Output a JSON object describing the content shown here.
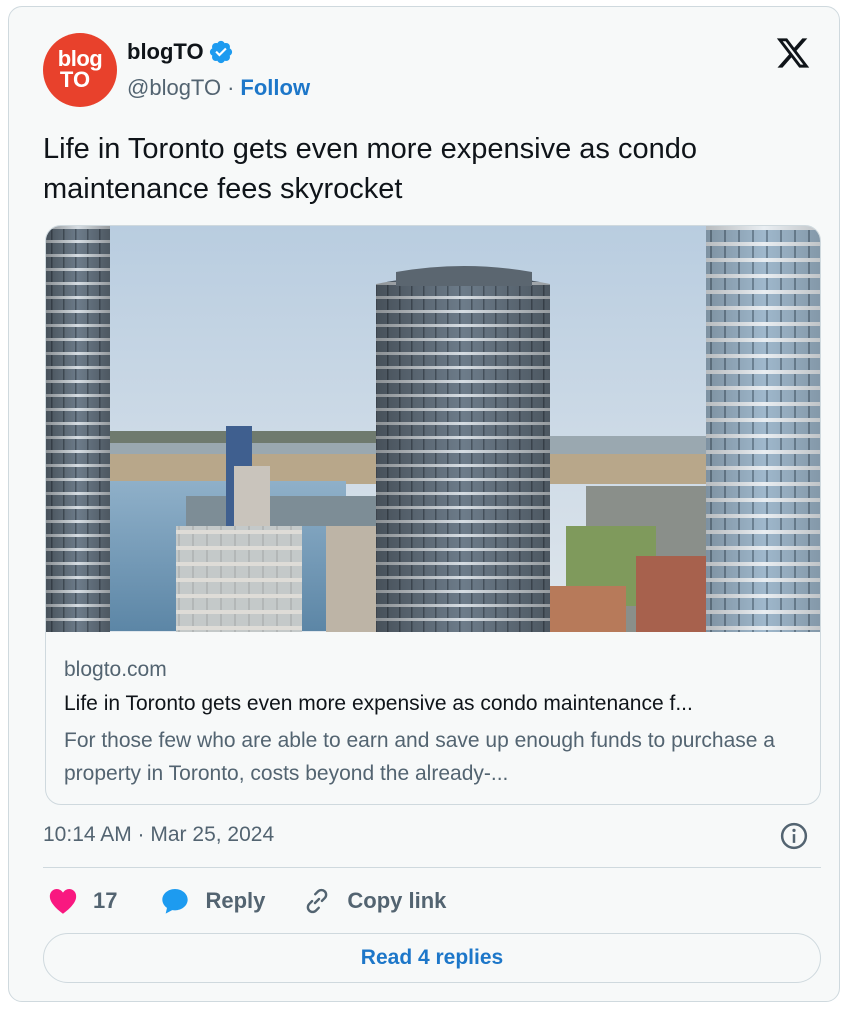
{
  "author": {
    "avatar_line1": "blog",
    "avatar_line2": "TO",
    "name": "blogTO",
    "handle": "@blogTO",
    "separator": "·",
    "follow_label": "Follow"
  },
  "tweet": {
    "text": "Life in Toronto gets even more expensive as condo maintenance fees skyrocket"
  },
  "link_card": {
    "domain": "blogto.com",
    "title": "Life in Toronto gets even more expensive as condo maintenance f...",
    "description": "For those few who are able to earn and save up enough funds to purchase a property in Toronto, costs beyond the already-..."
  },
  "meta": {
    "timestamp": "10:14 AM · Mar 25, 2024"
  },
  "actions": {
    "like_count": "17",
    "reply_label": "Reply",
    "copy_label": "Copy link"
  },
  "footer": {
    "read_replies_label": "Read 4 replies"
  },
  "icons": {
    "verified": "verified-badge-icon",
    "x_logo": "x-logo-icon",
    "info": "info-icon",
    "heart": "heart-icon",
    "reply": "reply-bubble-icon",
    "link": "link-icon"
  },
  "colors": {
    "accent": "#1d77c9",
    "like": "#f91880",
    "brand": "#e8412c",
    "text": "#0f1419",
    "muted": "#536471"
  }
}
